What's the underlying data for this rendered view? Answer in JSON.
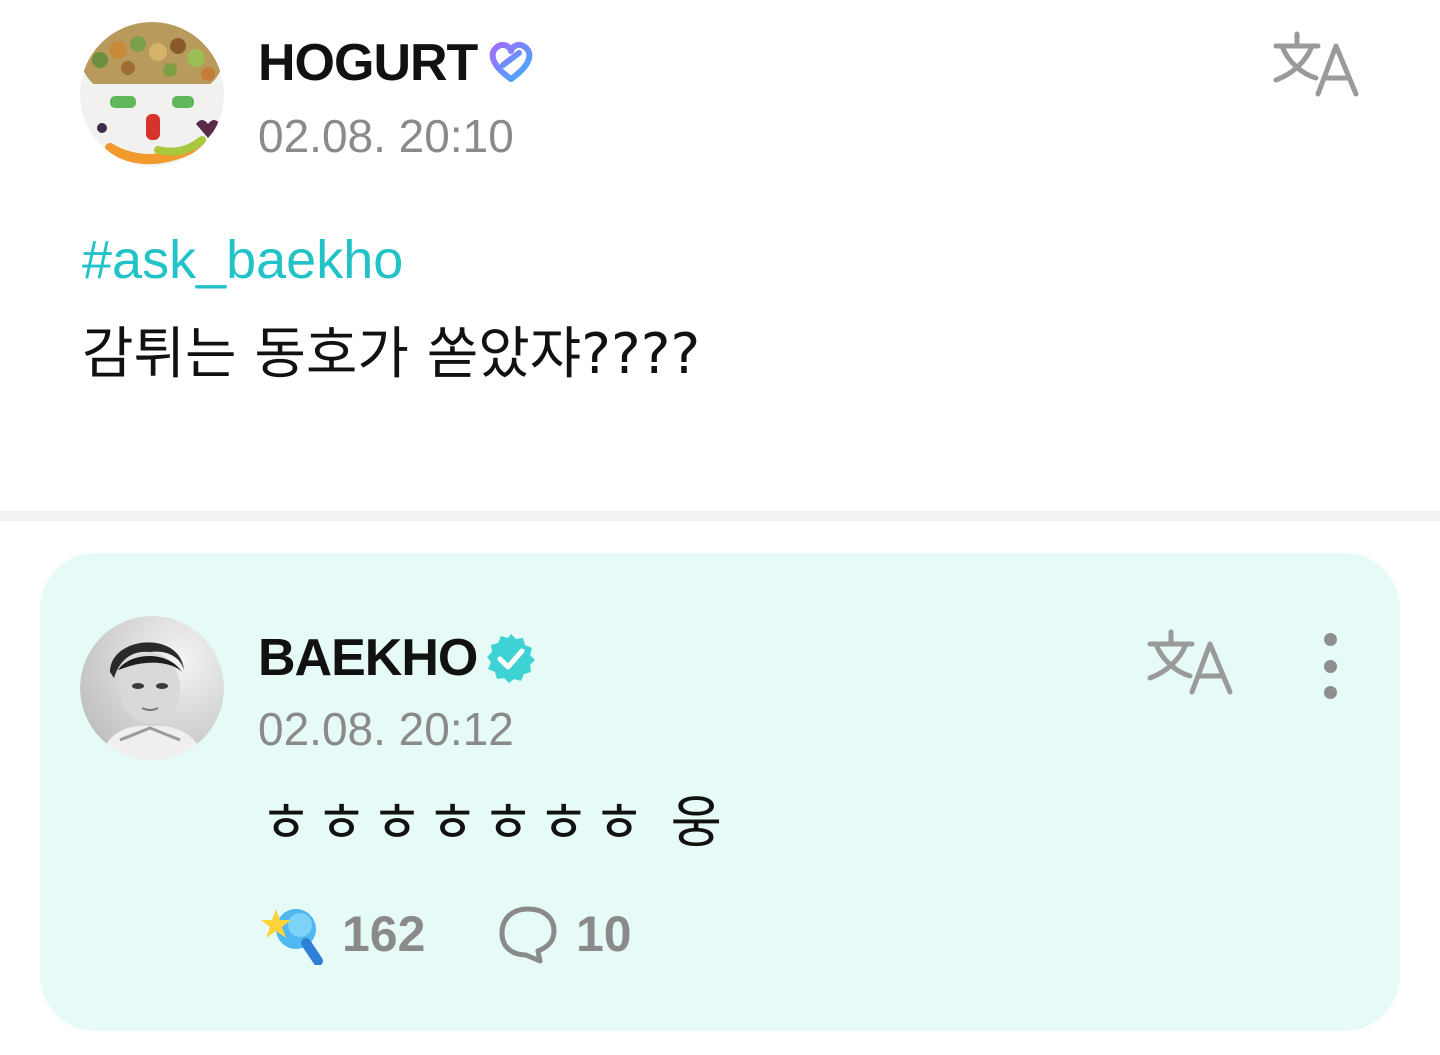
{
  "post": {
    "author": {
      "name": "HOGURT",
      "badge_icon": "heart-membership-badge-icon"
    },
    "timestamp": "02.08. 20:10",
    "hashtag": "#ask_baekho",
    "body": "감튀는 동호가 쏟았쟈????"
  },
  "reply": {
    "author": {
      "name": "BAEKHO",
      "badge_icon": "verified-badge-icon"
    },
    "timestamp": "02.08. 20:12",
    "body": "ㅎㅎㅎㅎㅎㅎㅎ 웅",
    "likes": {
      "count": "162",
      "icon": "light-stick-icon"
    },
    "comments": {
      "count": "10",
      "icon": "speech-bubble-icon"
    }
  },
  "colors": {
    "accent": "#22c3c8",
    "reply_background": "#e6fbf7",
    "muted_text": "#8a8a8a",
    "divider": "#f2f2f2"
  }
}
